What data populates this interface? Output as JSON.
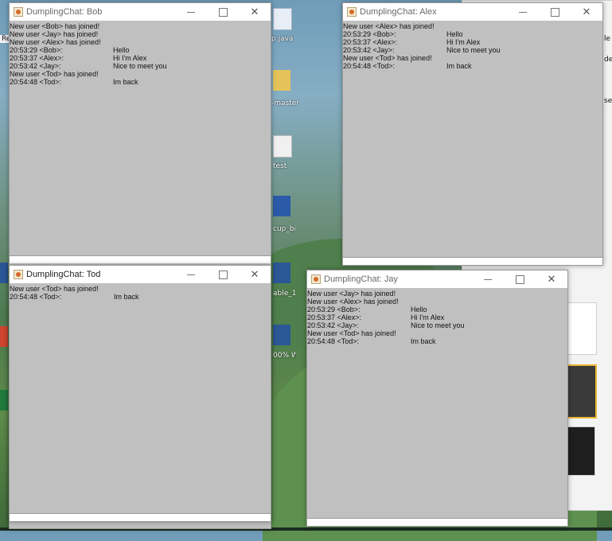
{
  "desktop": {
    "icon_labels": [
      "p.java",
      "-master",
      "test",
      "cup_bi",
      "able_1",
      "00% W"
    ],
    "edge_labels": [
      "Re",
      "le",
      "de",
      "se"
    ]
  },
  "windows": {
    "bob": {
      "title": "DumplingChat: Bob",
      "lines": [
        {
          "ts": "New user <Bob> has joined!",
          "msg": ""
        },
        {
          "ts": "New user <Jay> has joined!",
          "msg": ""
        },
        {
          "ts": "New user <Alex> has joined!",
          "msg": ""
        },
        {
          "ts": "20:53:29 <Bob>:",
          "msg": "Hello"
        },
        {
          "ts": "20:53:37 <Alex>:",
          "msg": "Hi I'm Alex"
        },
        {
          "ts": "20:53:42 <Jay>:",
          "msg": "Nice to meet you"
        },
        {
          "ts": "New user <Tod> has joined!",
          "msg": ""
        },
        {
          "ts": "20:54:48 <Tod>:",
          "msg": "Im back"
        }
      ]
    },
    "alex": {
      "title": "DumplingChat: Alex",
      "lines": [
        {
          "ts": "New user <Alex> has joined!",
          "msg": ""
        },
        {
          "ts": "20:53:29 <Bob>:",
          "msg": "Hello"
        },
        {
          "ts": "20:53:37 <Alex>:",
          "msg": "Hi I'm Alex"
        },
        {
          "ts": "20:53:42 <Jay>:",
          "msg": "Nice to meet you"
        },
        {
          "ts": "New user <Tod> has joined!",
          "msg": ""
        },
        {
          "ts": "20:54:48 <Tod>:",
          "msg": "Im back"
        }
      ]
    },
    "tod": {
      "title": "DumplingChat: Tod",
      "lines": [
        {
          "ts": "New user <Tod> has joined!",
          "msg": ""
        },
        {
          "ts": "20:54:48 <Tod>:",
          "msg": "Im back"
        }
      ]
    },
    "jay": {
      "title": "DumplingChat: Jay",
      "lines": [
        {
          "ts": "New user <Jay> has joined!",
          "msg": ""
        },
        {
          "ts": "New user <Alex> has joined!",
          "msg": ""
        },
        {
          "ts": "20:53:29 <Bob>:",
          "msg": "Hello"
        },
        {
          "ts": "20:53:37 <Alex>:",
          "msg": "Hi I'm Alex"
        },
        {
          "ts": "20:53:42 <Jay>:",
          "msg": "Nice to meet you"
        },
        {
          "ts": "New user <Tod> has joined!",
          "msg": ""
        },
        {
          "ts": "20:54:48 <Tod>:",
          "msg": "Im back"
        }
      ]
    }
  },
  "controls": {
    "minimize": "—",
    "maximize": "☐",
    "close": "✕"
  },
  "colors": {
    "chat_bg": "#c0c0c0",
    "titlebar_bg": "#ffffff"
  }
}
